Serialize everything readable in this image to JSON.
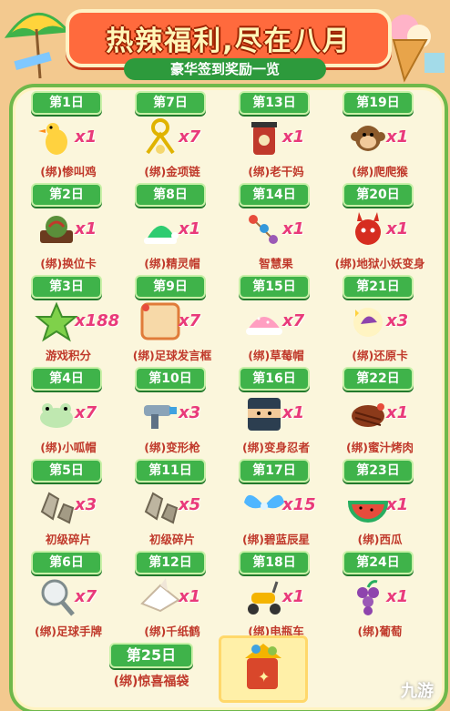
{
  "header": {
    "title": "热辣福利,尽在八月",
    "subtitle": "豪华签到奖励一览"
  },
  "days": [
    {
      "day": "第1日",
      "qty": "x1",
      "name": "(绑)惨叫鸡",
      "icon": "rubber-chicken-icon"
    },
    {
      "day": "第7日",
      "qty": "x7",
      "name": "(绑)金项链",
      "icon": "gold-chain-icon"
    },
    {
      "day": "第13日",
      "qty": "x1",
      "name": "(绑)老干妈",
      "icon": "sauce-jar-icon"
    },
    {
      "day": "第19日",
      "qty": "x1",
      "name": "(绑)爬爬猴",
      "icon": "monkey-icon"
    },
    {
      "day": "第2日",
      "qty": "x1",
      "name": "(绑)换位卡",
      "icon": "swap-card-icon"
    },
    {
      "day": "第8日",
      "qty": "x1",
      "name": "(绑)精灵帽",
      "icon": "elf-hat-icon"
    },
    {
      "day": "第14日",
      "qty": "x1",
      "name": "智慧果",
      "icon": "wisdom-fruit-icon"
    },
    {
      "day": "第20日",
      "qty": "x1",
      "name": "(绑)地狱小妖变身",
      "icon": "devil-icon"
    },
    {
      "day": "第3日",
      "qty": "x188",
      "name": "游戏积分",
      "icon": "star-points-icon"
    },
    {
      "day": "第9日",
      "qty": "x7",
      "name": "(绑)足球发言框",
      "icon": "speech-frame-icon"
    },
    {
      "day": "第15日",
      "qty": "x7",
      "name": "(绑)草莓帽",
      "icon": "strawberry-hat-icon"
    },
    {
      "day": "第21日",
      "qty": "x3",
      "name": "(绑)还原卡",
      "icon": "restore-card-icon"
    },
    {
      "day": "第4日",
      "qty": "x7",
      "name": "(绑)小呱帽",
      "icon": "frog-hat-icon"
    },
    {
      "day": "第10日",
      "qty": "x3",
      "name": "(绑)变形枪",
      "icon": "transform-gun-icon"
    },
    {
      "day": "第16日",
      "qty": "x1",
      "name": "(绑)变身忍者",
      "icon": "ninja-icon"
    },
    {
      "day": "第22日",
      "qty": "x1",
      "name": "(绑)蜜汁烤肉",
      "icon": "roast-meat-icon"
    },
    {
      "day": "第5日",
      "qty": "x3",
      "name": "初级碎片",
      "icon": "stone-fragment-icon"
    },
    {
      "day": "第11日",
      "qty": "x5",
      "name": "初级碎片",
      "icon": "stone-fragment-icon"
    },
    {
      "day": "第17日",
      "qty": "x15",
      "name": "(绑)碧蓝辰星",
      "icon": "blue-wings-icon"
    },
    {
      "day": "第23日",
      "qty": "x1",
      "name": "(绑)西瓜",
      "icon": "watermelon-icon"
    },
    {
      "day": "第6日",
      "qty": "x7",
      "name": "(绑)足球手牌",
      "icon": "racket-sign-icon"
    },
    {
      "day": "第12日",
      "qty": "x1",
      "name": "(绑)千纸鹤",
      "icon": "paper-crane-icon"
    },
    {
      "day": "第18日",
      "qty": "x1",
      "name": "(绑)电瓶车",
      "icon": "scooter-icon"
    },
    {
      "day": "第24日",
      "qty": "x1",
      "name": "(绑)葡萄",
      "icon": "grape-icon"
    }
  ],
  "final_day": {
    "day": "第25日",
    "name": "(绑)惊喜福袋",
    "icon": "surprise-bag-icon"
  },
  "watermark": "九游",
  "colors": {
    "accent_green": "#3fb34a",
    "qty_pink": "#e93a7a",
    "name_red": "#c0392b",
    "banner_orange": "#ff6a3d"
  }
}
